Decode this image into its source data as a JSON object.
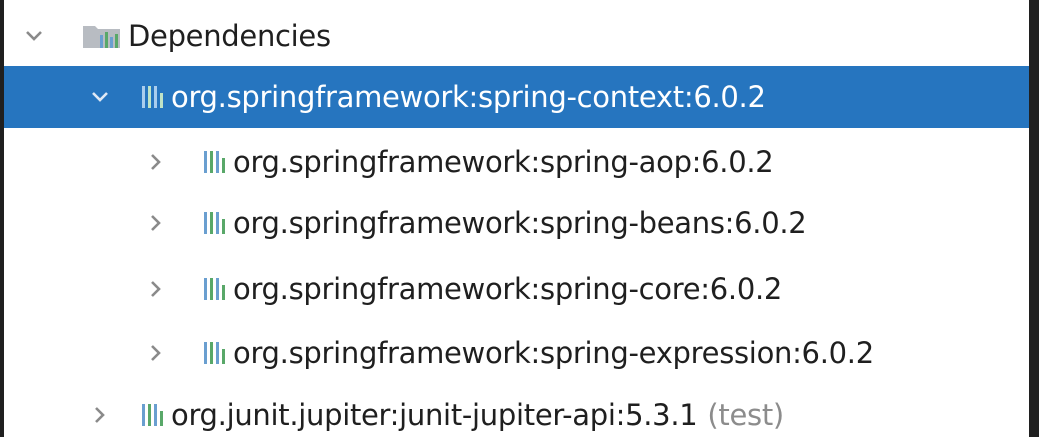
{
  "tree": {
    "root": {
      "label": "Dependencies",
      "expanded": true,
      "icon": "library-folder-icon"
    },
    "items": [
      {
        "label": "org.springframework:spring-context:6.0.2",
        "expanded": true,
        "selected": true,
        "icon": "maven-library-icon",
        "children": [
          {
            "label": "org.springframework:spring-aop:6.0.2",
            "expanded": false,
            "icon": "maven-library-icon"
          },
          {
            "label": "org.springframework:spring-beans:6.0.2",
            "expanded": false,
            "icon": "maven-library-icon"
          },
          {
            "label": "org.springframework:spring-core:6.0.2",
            "expanded": false,
            "icon": "maven-library-icon"
          },
          {
            "label": "org.springframework:spring-expression:6.0.2",
            "expanded": false,
            "icon": "maven-library-icon"
          }
        ]
      },
      {
        "label": "org.junit.jupiter:junit-jupiter-api:5.3.1",
        "scope": "(test)",
        "expanded": false,
        "selected": false,
        "icon": "maven-library-icon"
      }
    ]
  },
  "colors": {
    "selection": "#2675bf",
    "text": "#1f1f1f",
    "scope_text": "#8c8c8c",
    "chevron": "#8a8a8a",
    "library_bars": [
      "#6a9fd0",
      "#59a869",
      "#6a9fd0",
      "#59a869"
    ]
  }
}
